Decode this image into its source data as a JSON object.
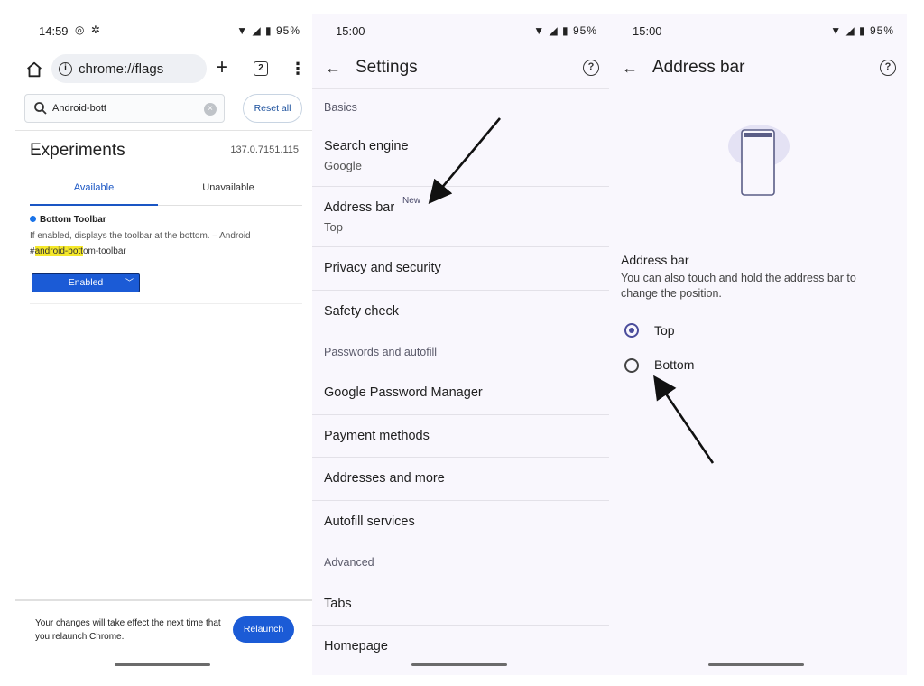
{
  "panels": {
    "flags": {
      "status": {
        "time": "14:59",
        "battery": "95%"
      },
      "omnibox_url": "chrome://flags",
      "tab_count": "2",
      "search": {
        "value": "Android-bott"
      },
      "reset_all": "Reset all",
      "experiments_title": "Experiments",
      "version": "137.0.7151.115",
      "tabs": {
        "available": "Available",
        "unavailable": "Unavailable"
      },
      "flag": {
        "title": "Bottom Toolbar",
        "description": "If enabled, displays the toolbar at the bottom. – Android",
        "link_prefix": "#",
        "link_highlight": "android-bott",
        "link_rest": "om-toolbar",
        "state": "Enabled"
      },
      "relaunch_message": "Your changes will take effect the next time that you relaunch Chrome.",
      "relaunch_button": "Relaunch"
    },
    "settings": {
      "status": {
        "time": "15:00",
        "battery": "95%"
      },
      "title": "Settings",
      "sections": {
        "basics": "Basics",
        "passwords": "Passwords and autofill",
        "advanced": "Advanced"
      },
      "items": {
        "search_engine": {
          "label": "Search engine",
          "sub": "Google"
        },
        "address_bar": {
          "label": "Address bar",
          "badge": "New",
          "sub": "Top"
        },
        "privacy": "Privacy and security",
        "safety": "Safety check",
        "gpm": "Google Password Manager",
        "payment": "Payment methods",
        "addresses": "Addresses and more",
        "autofill": "Autofill services",
        "tabs": "Tabs",
        "homepage": "Homepage"
      }
    },
    "address_bar": {
      "status": {
        "time": "15:00",
        "battery": "95%"
      },
      "title": "Address bar",
      "heading": "Address bar",
      "description": "You can also touch and hold the address bar to change the position.",
      "options": {
        "top": "Top",
        "bottom": "Bottom"
      },
      "selected": "Top"
    }
  },
  "colors": {
    "accent_blue": "#1b5bd6",
    "radio_selected": "#4b4d9c",
    "settings_bg": "#f9f7fd",
    "highlight": "#f5e82a"
  }
}
